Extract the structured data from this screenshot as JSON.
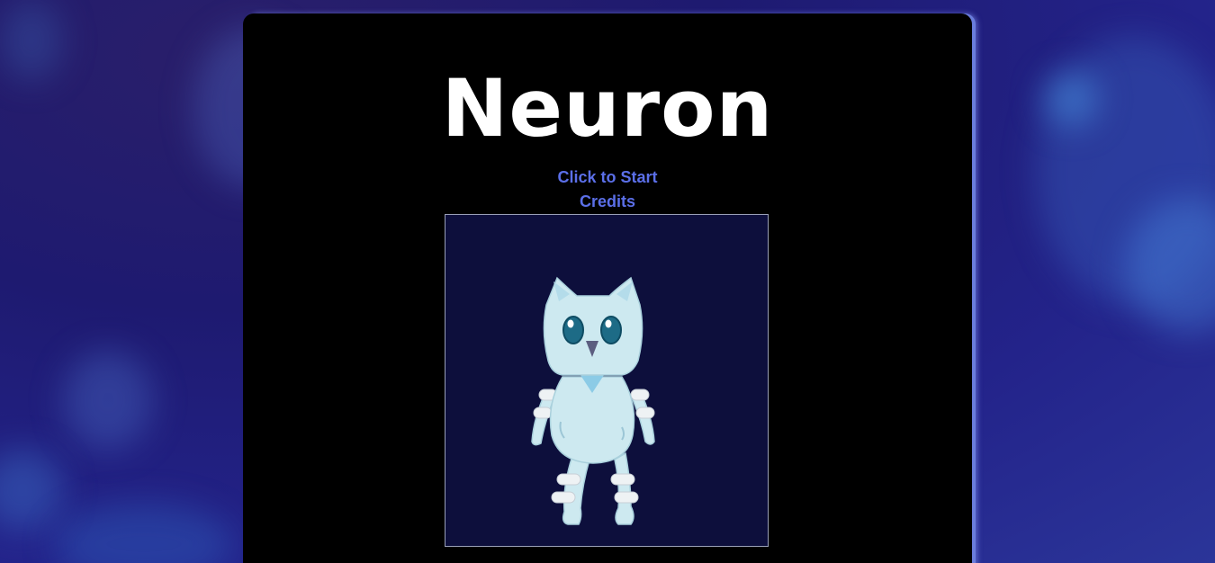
{
  "game": {
    "title": "Neuron",
    "menu": {
      "start_label": "Click to Start",
      "credits_label": "Credits"
    }
  },
  "colors": {
    "panel_background": "#000000",
    "link_color": "#5b6fe8",
    "canvas_background": "#0d0f3c",
    "character_body": "#cde9f0"
  },
  "character": {
    "icon": "owl-cat-character-icon"
  }
}
